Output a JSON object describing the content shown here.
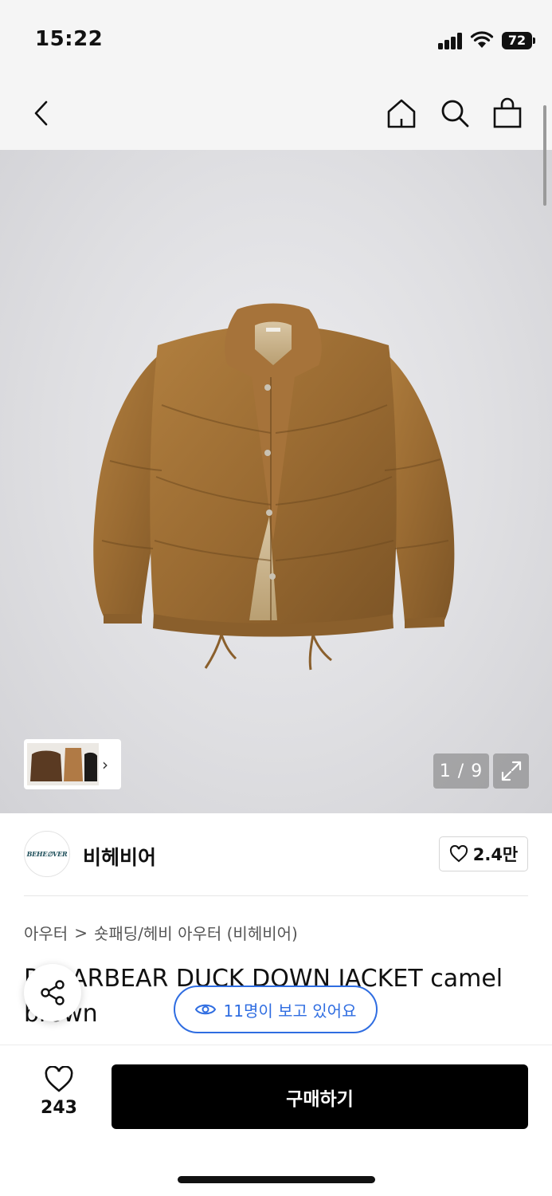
{
  "status_bar": {
    "time": "15:22",
    "battery": "72",
    "icons": [
      "signal-icon",
      "wifi-icon",
      "battery-icon"
    ]
  },
  "nav": {
    "icons": [
      "back-icon",
      "home-icon",
      "search-icon",
      "bag-icon"
    ]
  },
  "gallery": {
    "page_indicator": "1 / 9",
    "current_page": 1,
    "total_pages": 9,
    "colors": {
      "jacket": "#9a6b32",
      "background": "#dfdfe2"
    }
  },
  "brand": {
    "logo_text": "BEHE∅VER",
    "name": "비헤비어",
    "like_count": "2.4만"
  },
  "breadcrumb": {
    "items": [
      "아우터",
      "숏패딩/헤비 아우터 (비헤비어)"
    ],
    "separator": ">"
  },
  "product": {
    "title": "POLARBEAR DUCK DOWN JACKET camel brown"
  },
  "viewers": {
    "text": "11명이 보고 있어요",
    "color": "#2f6de1"
  },
  "bottom_bar": {
    "wish_count": "243",
    "buy_label": "구매하기"
  }
}
